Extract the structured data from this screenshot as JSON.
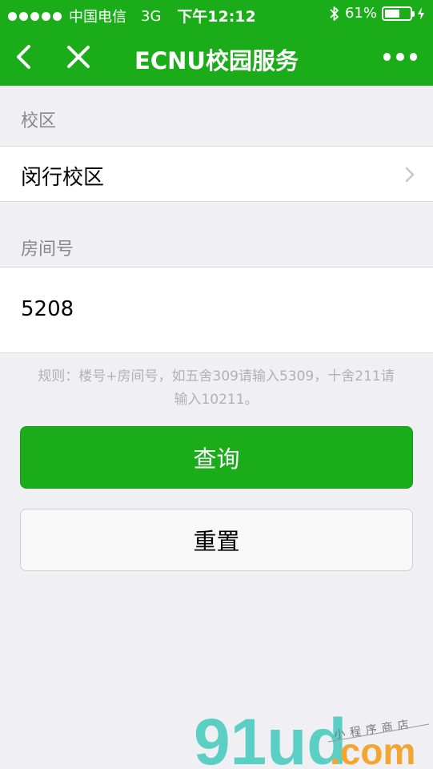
{
  "status_bar": {
    "carrier": "中国电信",
    "network": "3G",
    "time": "下午12:12",
    "battery_text": "61%",
    "battery_level": 0.61
  },
  "nav": {
    "title": "ECNU校园服务"
  },
  "form": {
    "campus_label": "校区",
    "campus_value": "闵行校区",
    "room_label": "房间号",
    "room_value": "5208",
    "hint_line1": "规则：楼号+房间号，如五舍309请输入5309，十舍211请",
    "hint_line2": "输入10211。"
  },
  "buttons": {
    "query": "查询",
    "reset": "重置"
  },
  "watermark": {
    "brand": "91ud",
    "suffix": ".com",
    "tagline": "小程序商店"
  },
  "colors": {
    "brand_green": "#1aad19",
    "background": "#efeff4"
  }
}
